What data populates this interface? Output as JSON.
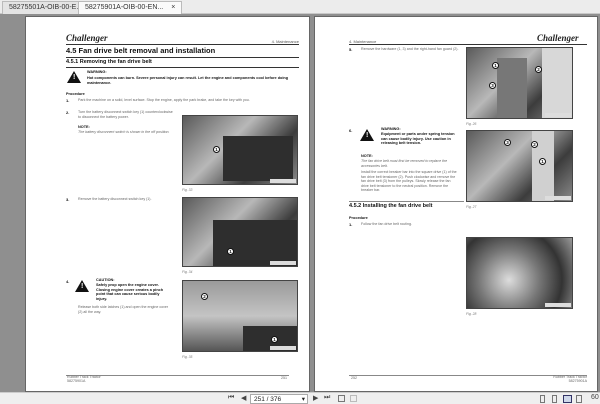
{
  "tabs": [
    {
      "label": "58275501A-OIB-00-E..."
    },
    {
      "label": "58275901A-OIB-00-EN...",
      "close": "×"
    }
  ],
  "left_page": {
    "logo": "Challenger",
    "section_ref": "4. Maintenance",
    "title": "4.5   Fan drive belt removal and installation",
    "subtitle": "4.5.1  Removing the fan drive belt",
    "warning_label": "WARNING:",
    "warning_text": "Hot components can burn. Severe personal injury can result. Let the engine and components cool before doing maintenance.",
    "procedure": "Procedure",
    "steps": [
      {
        "n": "1.",
        "text": "Park the machine on a solid, level surface. Stop the engine, apply the park brake, and take the key with you."
      },
      {
        "n": "2.",
        "text": "Turn the battery disconnect switch key (1) counterclockwise to disconnect the battery power."
      },
      {
        "n": "3.",
        "text": "Remove the battery disconnect switch key (1)."
      },
      {
        "n": "4.",
        "text": "Release both side latches (1) and open the engine cover (2) all the way."
      }
    ],
    "note_label": "NOTE:",
    "note_text": "The battery disconnect switch is shown in the off position.",
    "caution_label": "CAUTION:",
    "caution_text": "Safely prop open the engine cover. Closing engine cover creates a pinch point that can cause serious bodily injury.",
    "figs": [
      "Fig. 33",
      "Fig. 34",
      "Fig. 35"
    ],
    "footer_title": "Rubber Track Tractor",
    "footer_code": "58275901A",
    "page_no": "251"
  },
  "right_page": {
    "logo": "Challenger",
    "section_ref": "4. Maintenance",
    "steps": [
      {
        "n": "5.",
        "text": "Remove the hardware (1, 3) and the right-hand fan guard (2)."
      },
      {
        "n": "6.",
        "text": ""
      }
    ],
    "warning_label": "WARNING:",
    "warning_text": "Equipment or parts under spring tension can cause bodily injury. Use caution in releasing belt tension.",
    "note_label": "NOTE:",
    "note_text": "The fan drive belt must first be removed to replace the accessories belt.",
    "step6_text": "Install the correct breaker bar into the square drive (1) of the fan drive belt tensioner (2). Push clockwise and remove the fan drive belt (3) from the pulleys. Slowly release the fan drive belt tensioner to the neutral position. Remove the breaker bar.",
    "subtitle": "4.5.2  Installing the fan drive belt",
    "procedure": "Procedure",
    "step1": {
      "n": "1.",
      "text": "Follow the fan drive belt routing."
    },
    "figs": [
      "Fig. 26",
      "Fig. 27",
      "Fig. 28"
    ],
    "footer_title": "Rubber Track Tractor",
    "footer_code": "58275901A",
    "page_no": "252"
  },
  "toolbar": {
    "first": "⏮",
    "prev": "◀",
    "page": "251 / 376",
    "dropdown": "▾",
    "next": "▶",
    "last": "⏭",
    "zoom": "60"
  }
}
